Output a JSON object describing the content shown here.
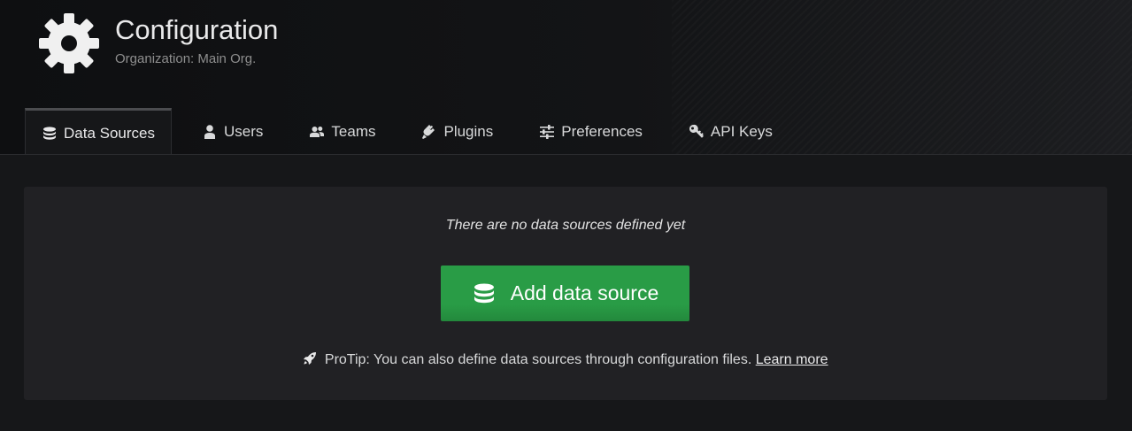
{
  "header": {
    "icon": "gear-icon",
    "title": "Configuration",
    "subtitle": "Organization: Main Org."
  },
  "tabs": [
    {
      "label": "Data Sources",
      "icon": "database-icon",
      "active": true
    },
    {
      "label": "Users",
      "icon": "user-icon",
      "active": false
    },
    {
      "label": "Teams",
      "icon": "users-icon",
      "active": false
    },
    {
      "label": "Plugins",
      "icon": "plug-icon",
      "active": false
    },
    {
      "label": "Preferences",
      "icon": "sliders-icon",
      "active": false
    },
    {
      "label": "API Keys",
      "icon": "key-icon",
      "active": false
    }
  ],
  "empty_state": {
    "message": "There are no data sources defined yet",
    "button_label": "Add data source",
    "button_icon": "database-icon",
    "button_color": "#299c46",
    "protip_icon": "rocket-icon",
    "protip_text": "ProTip: You can also define data sources through configuration files.",
    "protip_link": "Learn more"
  }
}
